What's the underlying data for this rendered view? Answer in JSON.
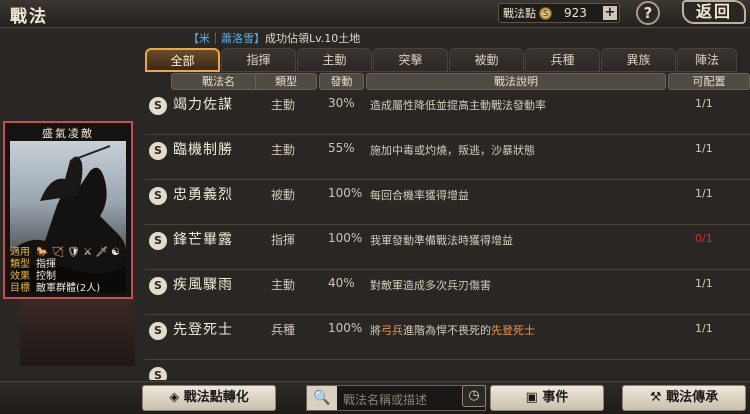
{
  "header": {
    "title": "戰法",
    "points_label": "戰法點",
    "points_coin": "S",
    "points_value": "923",
    "plus": "+",
    "help": "?",
    "back": "返回"
  },
  "notice": {
    "prefix": "【米｜蕭洛雪】",
    "text": "成功佔領Lv.10土地"
  },
  "tabs": [
    "全部",
    "指揮",
    "主動",
    "突擊",
    "被動",
    "兵種",
    "異族",
    "陣法"
  ],
  "table": {
    "headers": [
      "戰法名",
      "類型",
      "發動",
      "戰法說明",
      "可配置"
    ],
    "rows": [
      {
        "name": "竭力佐謀",
        "type": "主動",
        "rate": "30%",
        "desc": "造成屬性降低並提高主動戰法發動率",
        "cfg": "1/1",
        "cfg_red": false
      },
      {
        "name": "臨機制勝",
        "type": "主動",
        "rate": "55%",
        "desc": "施加中毒或灼燒，叛逃，沙暴狀態",
        "cfg": "1/1",
        "cfg_red": false
      },
      {
        "name": "忠勇義烈",
        "type": "被動",
        "rate": "100%",
        "desc": "每回合機率獲得增益",
        "cfg": "1/1",
        "cfg_red": false
      },
      {
        "name": "鋒芒畢露",
        "type": "指揮",
        "rate": "100%",
        "desc": "我軍發動準備戰法時獲得增益",
        "cfg": "0/1",
        "cfg_red": true
      },
      {
        "name": "疾風驟雨",
        "type": "主動",
        "rate": "40%",
        "desc": "對敵軍造成多次兵刃傷害",
        "cfg": "1/1",
        "cfg_red": false
      },
      {
        "name": "先登死士",
        "type": "兵種",
        "rate": "100%",
        "desc_a": "將",
        "desc_b": "弓兵",
        "desc_c": "進階為悍不畏死的",
        "desc_d": "先登死士",
        "cfg": "1/1",
        "cfg_red": false
      }
    ]
  },
  "card": {
    "title": "盛氣凌敵",
    "info": [
      {
        "k": "適用",
        "v": "🐎 🏹 🛡 ⚔ 🗡 ☯"
      },
      {
        "k": "類型",
        "v": "指揮"
      },
      {
        "k": "效果",
        "v": "控制"
      },
      {
        "k": "目標",
        "v": "敵軍群體(2人)"
      }
    ]
  },
  "bottom": {
    "convert_label": "戰法點轉化",
    "search_placeholder": "戰法名稱或描述",
    "events_label": "事件",
    "inherit_label": "戰法傳承"
  },
  "colors": {
    "tab_active_border": "#e8a84a",
    "card_border": "#c25050",
    "notice_blue": "#5fb0e8",
    "highlight_orange": "#e8984a",
    "cfg_red": "#d43030"
  }
}
